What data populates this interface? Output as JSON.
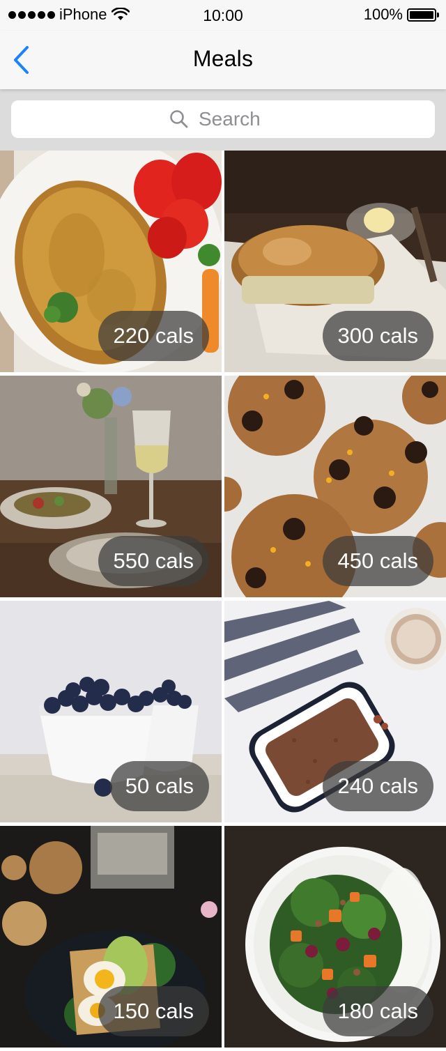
{
  "status_bar": {
    "carrier": "iPhone",
    "time": "10:00",
    "battery": "100%"
  },
  "nav": {
    "title": "Meals",
    "back_icon": "chevron-left-icon",
    "accent": "#1a82fb"
  },
  "search": {
    "placeholder": "Search",
    "value": "",
    "icon": "search-icon"
  },
  "meals": [
    {
      "calories": "220 cals",
      "photo": "omelette-with-tomatoes"
    },
    {
      "calories": "300 cals",
      "photo": "bread-loaf-with-butter"
    },
    {
      "calories": "550 cals",
      "photo": "table-with-wine-and-salad"
    },
    {
      "calories": "450 cals",
      "photo": "chocolate-chip-cookies"
    },
    {
      "calories": "50 cals",
      "photo": "bowls-of-blueberries"
    },
    {
      "calories": "240 cals",
      "photo": "granola-tray-with-coffee"
    },
    {
      "calories": "150 cals",
      "photo": "eggs-and-avocado-toast"
    },
    {
      "calories": "180 cals",
      "photo": "salad-bowl"
    }
  ]
}
